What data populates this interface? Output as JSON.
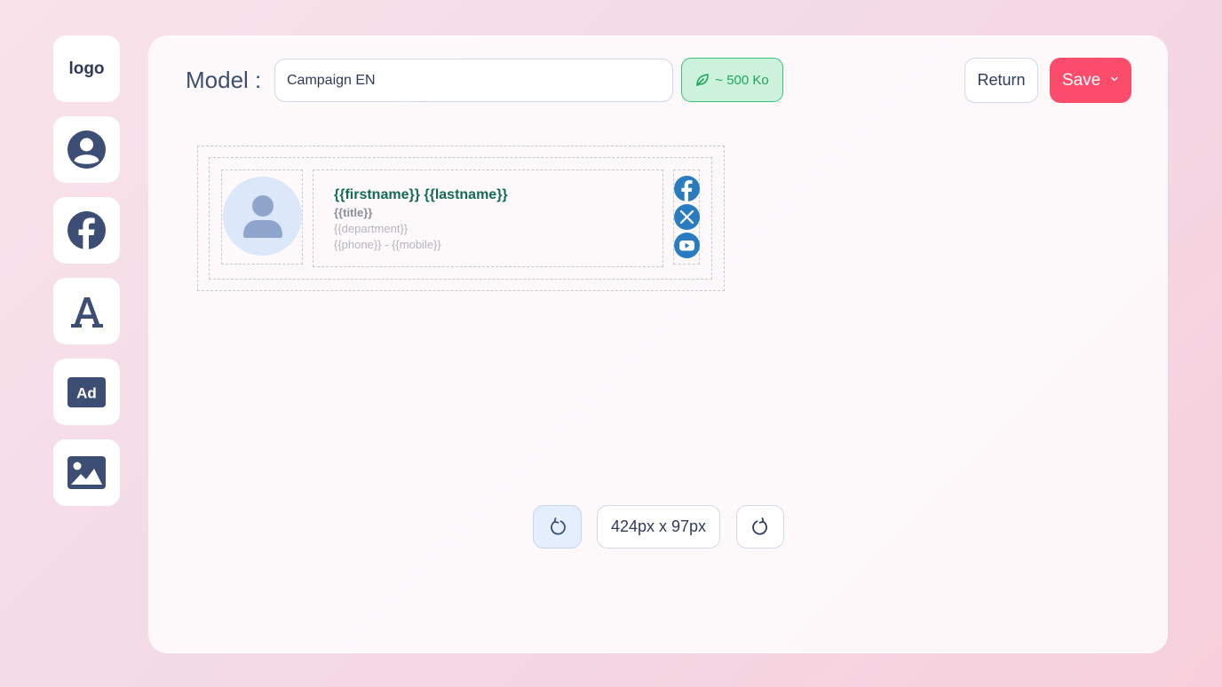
{
  "sidebar": {
    "logo_label": "logo",
    "items": [
      {
        "name": "user-icon"
      },
      {
        "name": "facebook-icon"
      },
      {
        "name": "font-icon"
      },
      {
        "name": "ad-icon"
      },
      {
        "name": "image-icon"
      }
    ]
  },
  "header": {
    "model_label": "Model :",
    "model_value": "Campaign EN",
    "weight_badge": "~ 500 Ko",
    "return_label": "Return",
    "save_label": "Save"
  },
  "signature": {
    "name": "{{firstname}} {{lastname}}",
    "title": "{{title}}",
    "department": "{{department}}",
    "phones": "{{phone}} - {{mobile}}",
    "social": [
      "facebook-icon",
      "x-icon",
      "youtube-icon"
    ]
  },
  "controls": {
    "dimensions": "424px x 97px"
  },
  "colors": {
    "accent": "#fb4d6b",
    "primary": "#2f3b5c",
    "eco_green": "#1ea75b",
    "name_green": "#146b53",
    "social_blue": "#2a7cc1"
  }
}
